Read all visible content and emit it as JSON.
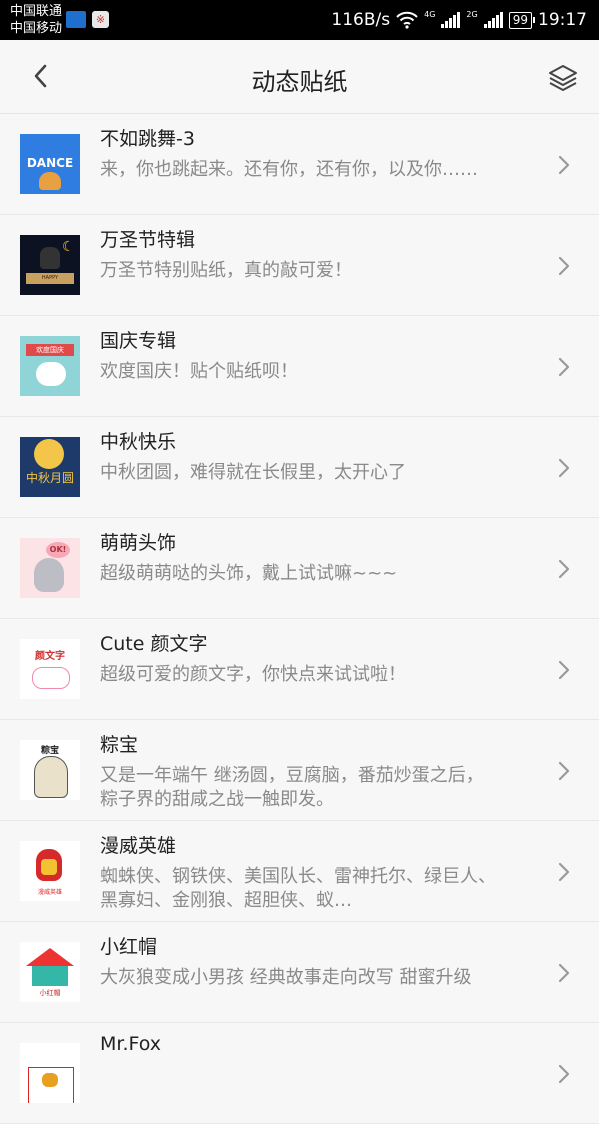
{
  "status_bar": {
    "carrier1": "中国联通",
    "carrier2": "中国移动",
    "speed": "116B/s",
    "net1": "4G",
    "net2": "2G",
    "battery": "99",
    "time": "19:17"
  },
  "header": {
    "title": "动态贴纸"
  },
  "items": [
    {
      "title": "不如跳舞-3",
      "desc": "来，你也跳起来。还有你，还有你，以及你……",
      "thumb_text": "DANCE"
    },
    {
      "title": "万圣节特辑",
      "desc": "万圣节特别贴纸，真的敲可爱！",
      "thumb_text": "HAPPY HALLOWEEN"
    },
    {
      "title": "国庆专辑",
      "desc": "欢度国庆！贴个贴纸呗！",
      "thumb_text": "欢度国庆"
    },
    {
      "title": "中秋快乐",
      "desc": "中秋团圆，难得就在长假里，太开心了",
      "thumb_text": "中秋月圆"
    },
    {
      "title": "萌萌头饰",
      "desc": "超级萌萌哒的头饰，戴上试试嘛~~~",
      "thumb_text": "OK!"
    },
    {
      "title": "Cute 颜文字",
      "desc": "超级可爱的颜文字，你快点来试试啦！",
      "thumb_text": "颜文字"
    },
    {
      "title": "粽宝",
      "desc": "又是一年端午 继汤圆，豆腐脑，番茄炒蛋之后，粽子界的甜咸之战一触即发。",
      "thumb_text": "粽宝"
    },
    {
      "title": "漫威英雄",
      "desc": "蜘蛛侠、钢铁侠、美国队长、雷神托尔、绿巨人、黑寡妇、金刚狼、超胆侠、蚁…",
      "thumb_text": "漫威英雄"
    },
    {
      "title": "小红帽",
      "desc": "大灰狼变成小男孩 经典故事走向改写 甜蜜升级",
      "thumb_text": "小红帽"
    },
    {
      "title": "Mr.Fox",
      "desc": "",
      "thumb_text": ""
    }
  ]
}
